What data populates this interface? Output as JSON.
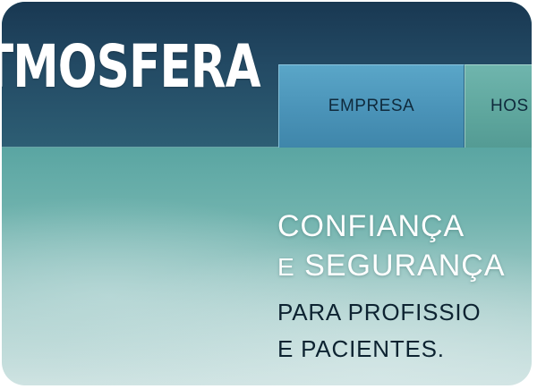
{
  "header": {
    "logo_text": "TMOSFERA",
    "nav": [
      {
        "label": "EMPRESA"
      },
      {
        "label": "HOS"
      }
    ]
  },
  "hero": {
    "line1": "CONFIANÇA",
    "line2_prefix": "E",
    "line2_rest": "SEGURANÇA",
    "line3": "PARA PROFISSIO",
    "line4": "E PACIENTES."
  },
  "colors": {
    "header": "#193852",
    "tab_empresa": "#4a93b8",
    "tab_hos": "#5ea69d",
    "hero_text_light": "#ffffff",
    "hero_text_dark": "#0d2331"
  }
}
